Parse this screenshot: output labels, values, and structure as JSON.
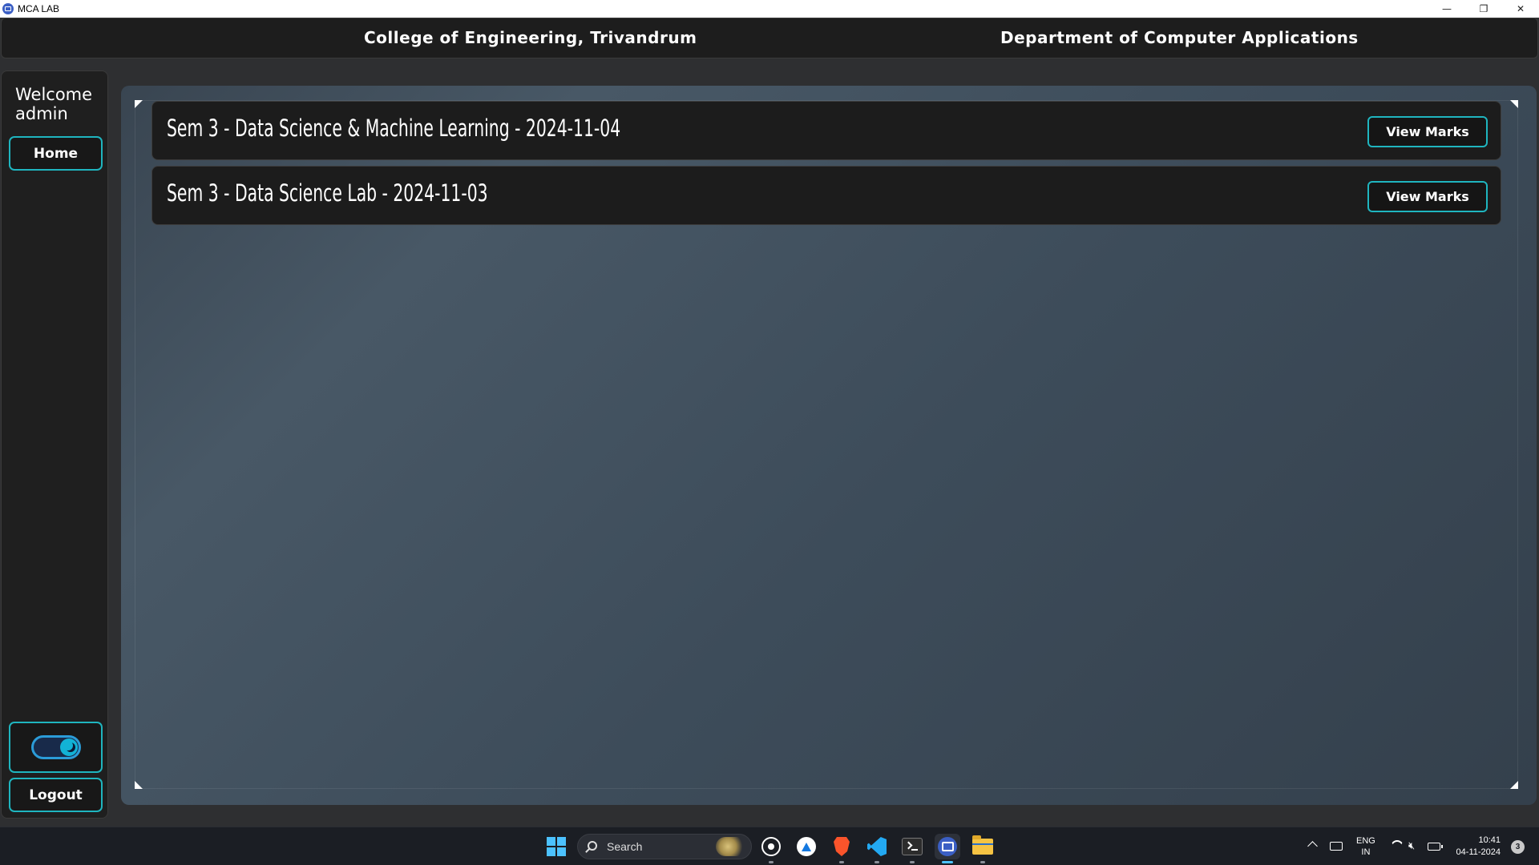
{
  "window": {
    "title": "MCA LAB",
    "controls": {
      "minimize": "—",
      "restore": "❐",
      "close": "✕"
    }
  },
  "header": {
    "college": "College of Engineering, Trivandrum",
    "department": "Department of Computer Applications"
  },
  "sidebar": {
    "welcome_line1": "Welcome",
    "welcome_line2": "admin",
    "home_label": "Home",
    "theme_toggle_on": true,
    "logout_label": "Logout"
  },
  "exams": [
    {
      "title": "Sem 3 - Data Science & Machine Learning - 2024-11-04",
      "button": "View Marks"
    },
    {
      "title": "Sem 3 - Data Science Lab - 2024-11-03",
      "button": "View Marks"
    }
  ],
  "taskbar": {
    "search_placeholder": "Search",
    "apps": [
      "start-icon",
      "whatsapp-icon",
      "store-icon",
      "brave-icon",
      "vscode-icon",
      "terminal-icon",
      "mca-lab-icon",
      "file-explorer-icon"
    ],
    "lang_line1": "ENG",
    "lang_line2": "IN",
    "time": "10:41",
    "date": "04-11-2024",
    "notifications": "3"
  },
  "colors": {
    "accent": "#1fb5bf",
    "panel": "#1c1c1c",
    "background": "#2e2f31"
  }
}
